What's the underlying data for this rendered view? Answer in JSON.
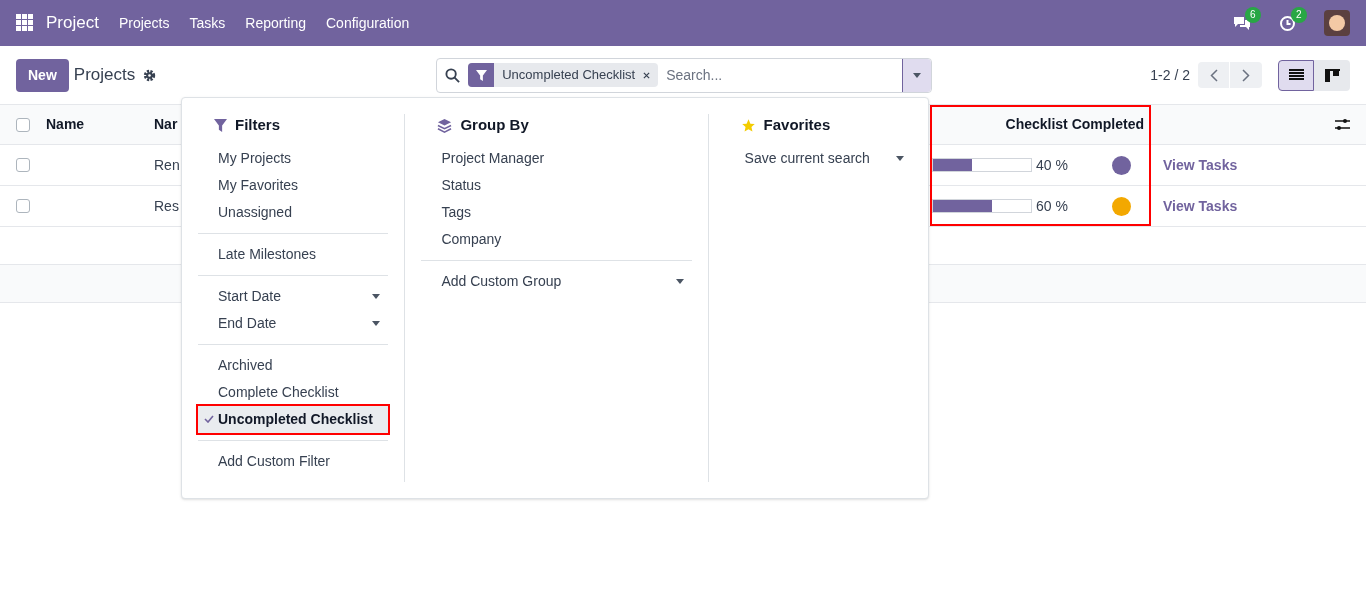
{
  "navbar": {
    "app": "Project",
    "menu": [
      "Projects",
      "Tasks",
      "Reporting",
      "Configuration"
    ],
    "messages_badge": "6",
    "activities_badge": "2"
  },
  "control_panel": {
    "new_button": "New",
    "title": "Projects",
    "facet": "Uncompleted Checklist",
    "search_placeholder": "Search...",
    "pager": "1-2 / 2",
    "views": [
      {
        "kind": "list",
        "selected": true
      },
      {
        "kind": "kanban",
        "selected": false
      }
    ]
  },
  "table": {
    "all_checked": false,
    "columns": [
      "Name",
      "Nar",
      "Checklist Completed"
    ],
    "rows": [
      {
        "checked": false,
        "column_2": "Ren",
        "level": 0.4,
        "reading": "40 %",
        "color": "#71639e",
        "link": "View Tasks"
      },
      {
        "checked": false,
        "column_2": "Res",
        "level": 0.6,
        "reading": "60 %",
        "color": "#f3a800",
        "link": "View Tasks"
      }
    ]
  },
  "search_panel": {
    "filters": {
      "title": "Filters",
      "sections": [
        [
          {
            "label": "My Projects",
            "kind": "option",
            "selected": false
          },
          {
            "label": "My Favorites",
            "kind": "option",
            "selected": false
          },
          {
            "label": "Unassigned",
            "kind": "option",
            "selected": false
          }
        ],
        [
          {
            "label": "Late Milestones",
            "kind": "option",
            "selected": false
          }
        ],
        [
          {
            "label": "Start Date",
            "kind": "date",
            "selected": false
          },
          {
            "label": "End Date",
            "kind": "date",
            "selected": false
          }
        ],
        [
          {
            "label": "Archived",
            "kind": "option",
            "selected": false
          },
          {
            "label": "Complete Checklist",
            "kind": "option",
            "selected": false
          },
          {
            "label": "Uncompleted Checklist",
            "kind": "option",
            "selected": true
          }
        ],
        [
          {
            "label": "Add Custom Filter",
            "kind": "option",
            "selected": false
          }
        ]
      ]
    },
    "group_by": {
      "title": "Group By",
      "items": [
        "Project Manager",
        "Status",
        "Tags",
        "Company"
      ],
      "custom": "Add Custom Group"
    },
    "favorites": {
      "title": "Favorites",
      "save": "Save current search"
    }
  }
}
